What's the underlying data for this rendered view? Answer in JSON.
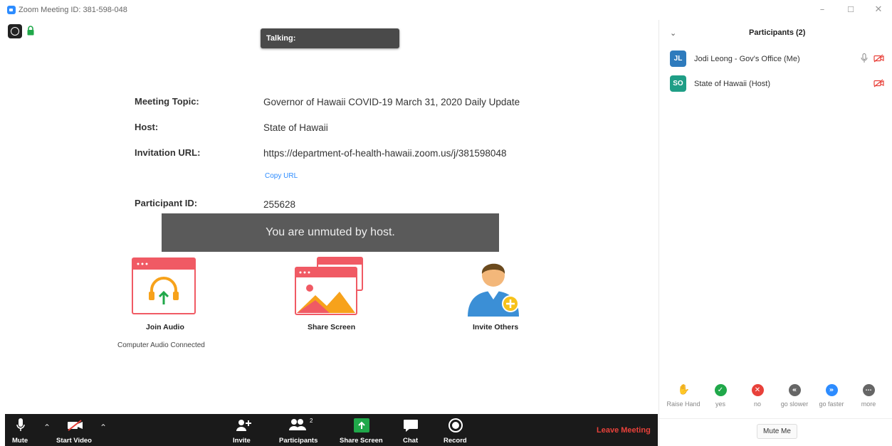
{
  "window": {
    "title": "Zoom Meeting ID: 381-598-048",
    "minimize": "–",
    "maximize": "☐",
    "close": "✕"
  },
  "talking": {
    "label": "Talking:"
  },
  "meeting_info": {
    "topic_label": "Meeting Topic:",
    "topic_value": "Governor of Hawaii COVID-19 March 31, 2020 Daily Update",
    "host_label": "Host:",
    "host_value": "State of Hawaii",
    "url_label": "Invitation URL:",
    "url_value": "https://department-of-health-hawaii.zoom.us/j/381598048",
    "copy_url": "Copy URL",
    "pid_label": "Participant ID:",
    "pid_value": "255628"
  },
  "toast": {
    "message": "You are unmuted by host."
  },
  "actions": {
    "join_audio": "Join Audio",
    "audio_status": "Computer Audio Connected",
    "share_screen": "Share Screen",
    "invite_others": "Invite Others"
  },
  "panel": {
    "title": "Participants (2)",
    "participants": [
      {
        "initials": "JL",
        "name": "Jodi Leong - Gov's Office (Me)",
        "color": "#2e7bbd"
      },
      {
        "initials": "SO",
        "name": "State of Hawaii (Host)",
        "color": "#1f9e86"
      }
    ],
    "reactions": [
      {
        "label": "Raise Hand",
        "color": "#2d8cff",
        "glyph": "✋"
      },
      {
        "label": "yes",
        "color": "#20a84a",
        "glyph": "✓"
      },
      {
        "label": "no",
        "color": "#e8413a",
        "glyph": "✕"
      },
      {
        "label": "go slower",
        "color": "#666666",
        "glyph": "«"
      },
      {
        "label": "go faster",
        "color": "#2d8cff",
        "glyph": "»"
      },
      {
        "label": "more",
        "color": "#666666",
        "glyph": "···"
      }
    ],
    "mute_me": "Mute Me"
  },
  "toolbar": {
    "mute": "Mute",
    "start_video": "Start Video",
    "invite": "Invite",
    "participants": "Participants",
    "participants_count": "2",
    "share_screen": "Share Screen",
    "chat": "Chat",
    "record": "Record",
    "leave": "Leave Meeting"
  },
  "colors": {
    "accent": "#2d8cff",
    "leave": "#e8413a",
    "share_green": "#20a84a",
    "toolbar_bg": "#1a1a1a"
  }
}
